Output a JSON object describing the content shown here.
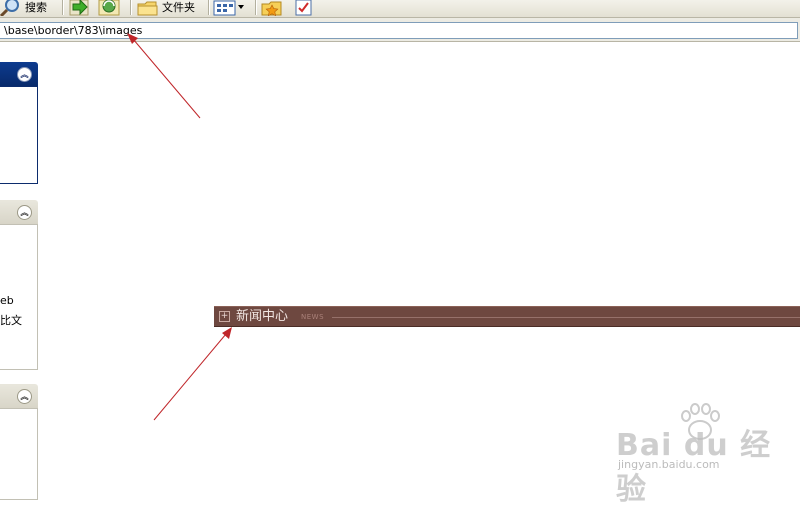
{
  "toolbar": {
    "search_label": "搜索",
    "folders_label": "文件夹"
  },
  "address": {
    "path": "\\base\\border\\783\\images"
  },
  "left_pane": {
    "section2_lines": [
      "eb",
      "比文"
    ]
  },
  "news": {
    "title": "新闻中心",
    "subtitle": "NEWS"
  },
  "watermark": {
    "logo": "Bai du 经验",
    "url": "jingyan.baidu.com"
  },
  "annotation_color": "#c0262a",
  "news_bar_color": "#6e4840",
  "pane_header_color": "#0d3b8f"
}
